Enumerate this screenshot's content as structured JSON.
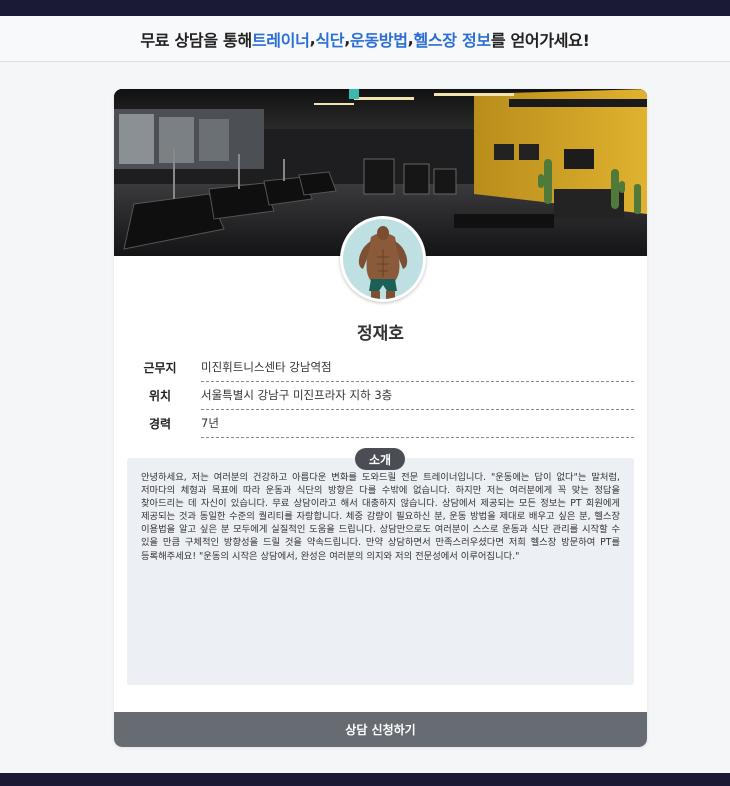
{
  "headline": {
    "prefix": "무료 상담을 통해",
    "kw1": "트레이너",
    "sep1": ", ",
    "kw2": "식단",
    "sep2": ", ",
    "kw3": "운동방법",
    "sep3": ", ",
    "kw4": "헬스장 정보",
    "suffix": "를 얻어가세요!"
  },
  "profile": {
    "name": "정재호",
    "info": [
      {
        "label": "근무지",
        "value": "미진휘트니스센타 강남역점"
      },
      {
        "label": "위치",
        "value": "서울특별시 강남구 미진프라자 지하 3층"
      },
      {
        "label": "경력",
        "value": "7년"
      }
    ],
    "intro_label": "소개",
    "intro_text": "안녕하세요, 저는 여러분의 건강하고 아름다운 변화를 도와드릴 전문 트레이너입니다. \"운동에는 답이 없다\"는 말처럼, 저마다의 체형과 목표에 따라 운동과 식단의 방향은 다를 수밖에 없습니다. 하지만 저는 여러분에게 꼭 맞는 정답을 찾아드리는 데 자신이 있습니다. 무료 상담이라고 해서 대충하지 않습니다. 상담에서 제공되는 모든 정보는 PT 회원에게 제공되는 것과 동일한 수준의 퀄리티를 자랑합니다. 체중 감량이 필요하신 분, 운동 방법을 제대로 배우고 싶은 분, 헬스장 이용법을 알고 싶은 분 모두에게 실질적인 도움을 드립니다. 상담만으로도 여러분이 스스로 운동과 식단 관리를 시작할 수 있을 만큼 구체적인 방향성을 드릴 것을 약속드립니다. 만약 상담하면서 만족스러우셨다면 저희 헬스장 방문하여 PT를 등록해주세요! \"운동의 시작은 상담에서, 완성은 여러분의 의지와 저의 전문성에서 이루어집니다.\""
  },
  "cta": {
    "label": "상담 신청하기"
  },
  "colors": {
    "accent": "#2b6fd6",
    "bar": "#1b1a35",
    "button": "#676b72",
    "badge": "#4a4d54"
  }
}
